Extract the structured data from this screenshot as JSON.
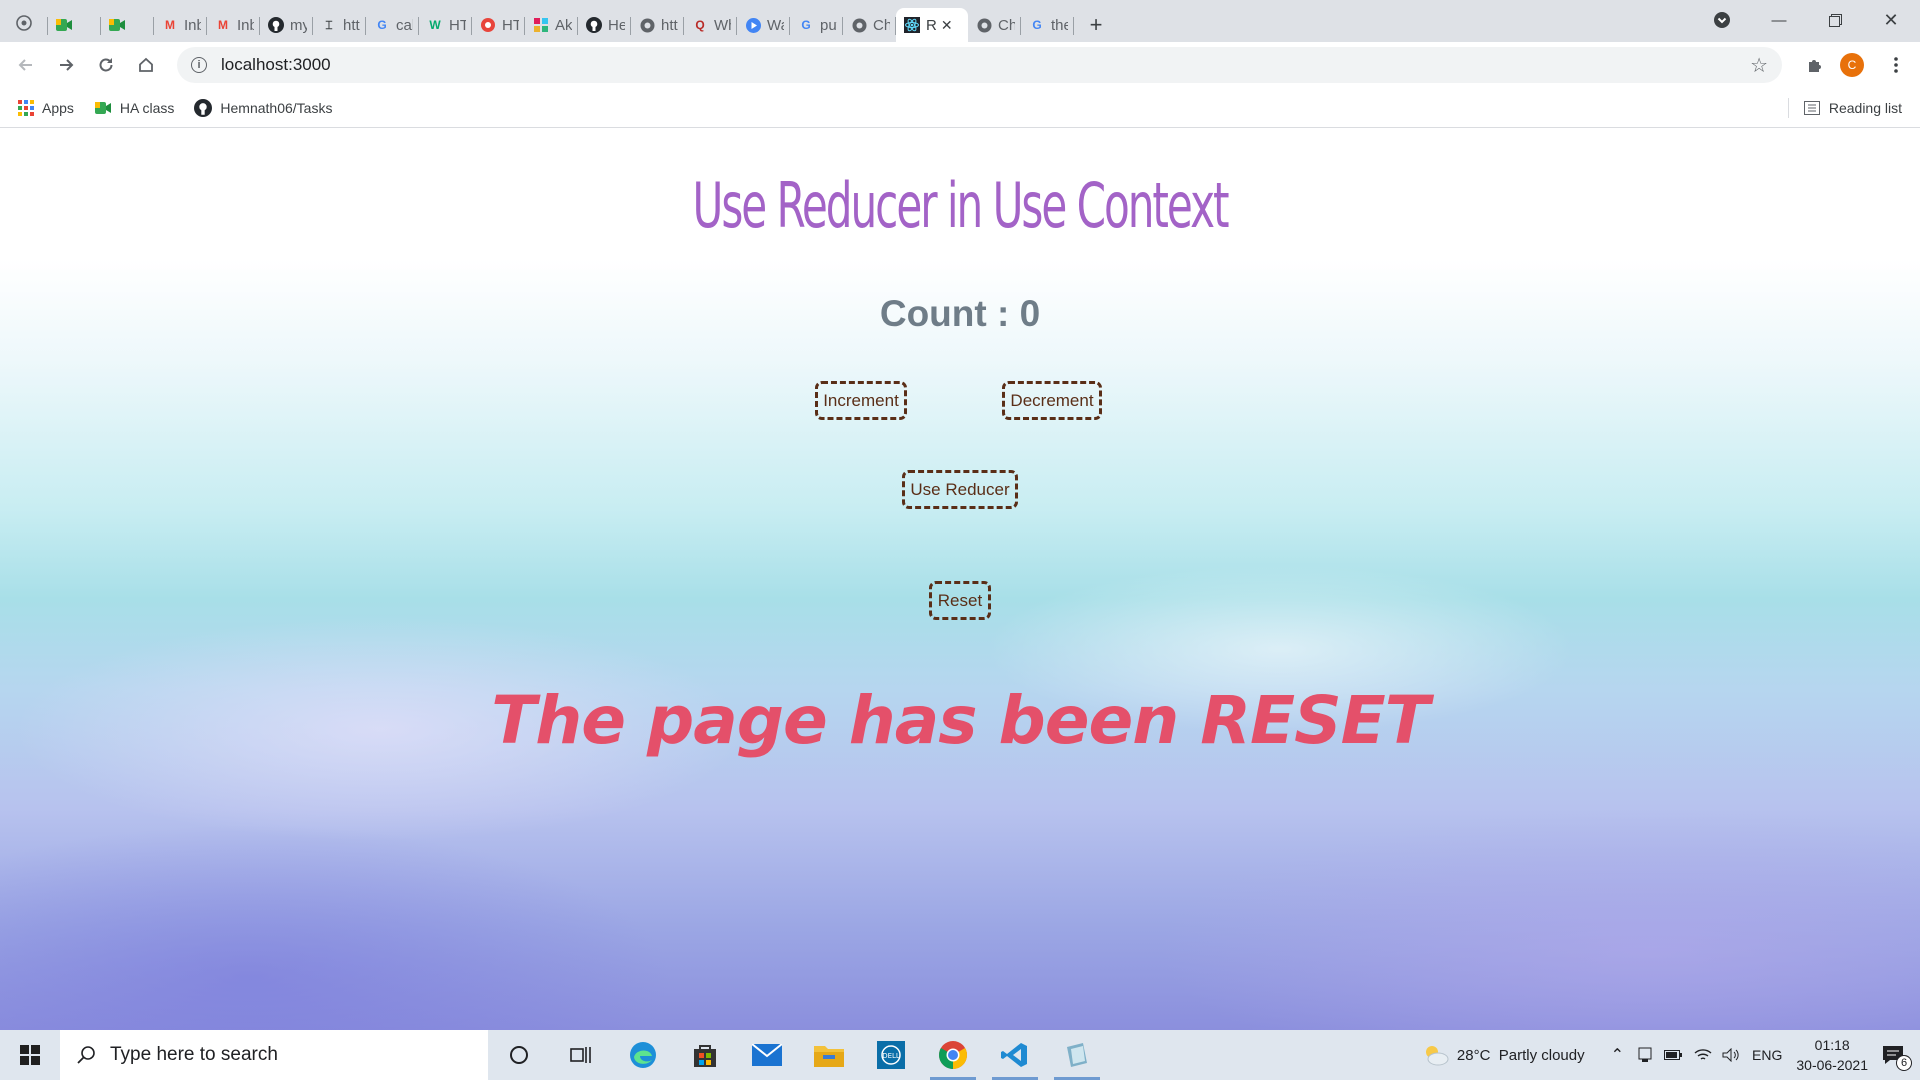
{
  "browser": {
    "tabs": [
      {
        "label": "",
        "icon": "chrome-apps-icon"
      },
      {
        "label": "",
        "icon": "meet-icon"
      },
      {
        "label": "",
        "icon": "meet-icon"
      },
      {
        "label": "Inbox",
        "icon": "gmail-icon"
      },
      {
        "label": "Inbox",
        "icon": "gmail-icon"
      },
      {
        "label": "my-a",
        "icon": "github-icon"
      },
      {
        "label": "https",
        "icon": "web-icon"
      },
      {
        "label": "calm",
        "icon": "google-icon"
      },
      {
        "label": "HTM",
        "icon": "w3schools-icon"
      },
      {
        "label": "HTM",
        "icon": "record-icon"
      },
      {
        "label": "Akay",
        "icon": "slack-icon"
      },
      {
        "label": "Hem",
        "icon": "github-icon"
      },
      {
        "label": "https",
        "icon": "globe-icon"
      },
      {
        "label": "Wher",
        "icon": "quora-icon"
      },
      {
        "label": "Watc",
        "icon": "play-icon"
      },
      {
        "label": "puth",
        "icon": "google-icon"
      },
      {
        "label": "Chon",
        "icon": "globe-icon"
      },
      {
        "label": "R",
        "icon": "react-icon",
        "active": true
      },
      {
        "label": "Chon",
        "icon": "globe-icon"
      },
      {
        "label": "the p",
        "icon": "google-icon"
      }
    ],
    "address": "localhost:3000",
    "profile_initial": "C",
    "bookmarks": [
      {
        "label": "Apps",
        "icon": "apps-grid-icon"
      },
      {
        "label": "HA class",
        "icon": "meet-icon"
      },
      {
        "label": "Hemnath06/Tasks",
        "icon": "github-icon"
      }
    ],
    "reading_list": "Reading list"
  },
  "page": {
    "heading": "Use Reducer in Use Context",
    "count_label": "Count : 0",
    "buttons": {
      "increment": "Increment",
      "decrement": "Decrement",
      "use_reducer": "Use Reducer",
      "reset": "Reset"
    },
    "message": "The page has been RESET"
  },
  "taskbar": {
    "search_placeholder": "Type here to search",
    "weather": "28°C  Partly cloudy",
    "language": "ENG",
    "time": "01:18",
    "date": "30-06-2021",
    "notifications": "6"
  },
  "colors": {
    "heading": "#a363c7",
    "count": "#6f7d88",
    "button_border": "#5a2e17",
    "message": "#e4506a"
  }
}
